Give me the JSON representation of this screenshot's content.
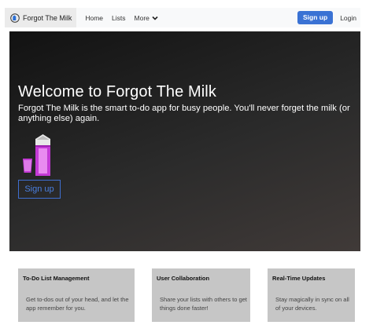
{
  "nav": {
    "brand": "Forgot The Milk",
    "brand_icon": "milk-logo-icon",
    "links": [
      "Home",
      "Lists",
      "More"
    ],
    "signup": "Sign up",
    "login": "Login"
  },
  "hero": {
    "title": "Welcome to Forgot The Milk",
    "subtitle": "Forgot The Milk is the smart to-do app for busy people. You'll never forget the milk (or anything else) again.",
    "art_icon": "milk-carton-and-glass-icon",
    "signup": "Sign up",
    "colors": {
      "accent": "#3a72d4",
      "milk": "#c43ad6"
    }
  },
  "features": [
    {
      "title": "To-Do List Management",
      "text": "Get to-dos out of your head, and let the app remember for you."
    },
    {
      "title": "User Collaboration",
      "text": "Share your lists with others to get things done faster!"
    },
    {
      "title": "Real-Time Updates",
      "text": "Stay magically in sync on all of your devices."
    }
  ]
}
